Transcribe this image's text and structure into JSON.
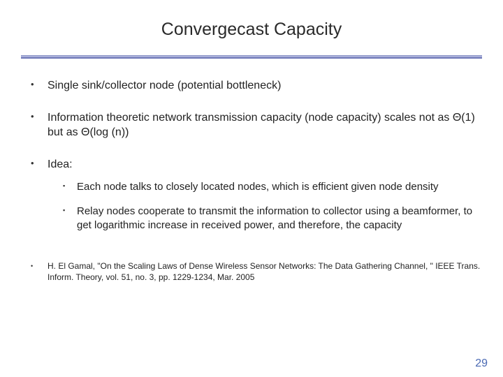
{
  "title": "Convergecast Capacity",
  "bullets": {
    "b1": "Single sink/collector node (potential bottleneck)",
    "b2": "Information theoretic network transmission capacity (node capacity) scales not as Θ(1) but as Θ(log (n))",
    "b3_label": "Idea:",
    "b3_sub1": "Each node talks to closely located nodes, which is efficient given node density",
    "b3_sub2": "Relay nodes cooperate to transmit the information to collector using a beamformer, to get logarithmic increase in received power, and therefore, the capacity"
  },
  "reference": "H. El Gamal, \"On the Scaling Laws of Dense Wireless Sensor Networks: The Data Gathering Channel, \" IEEE Trans. Inform. Theory, vol. 51, no. 3, pp. 1229-1234, Mar. 2005",
  "page_number": "29"
}
